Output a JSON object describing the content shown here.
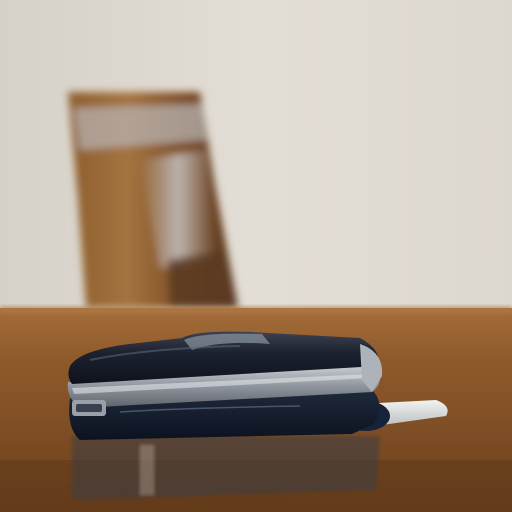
{
  "scene": {
    "subject": "flip-phone",
    "colors": {
      "wall_light": "#e2ddd4",
      "wall_shadow": "#cfc9bf",
      "chair_wood": "#8a5a2a",
      "chair_highlight": "#b9b4b3",
      "table_top": "#8e5a2c",
      "table_dark": "#5a3418",
      "phone_body": "#1b2130",
      "phone_silver": "#9ea3ab",
      "antenna": "#e4e4e2"
    }
  }
}
